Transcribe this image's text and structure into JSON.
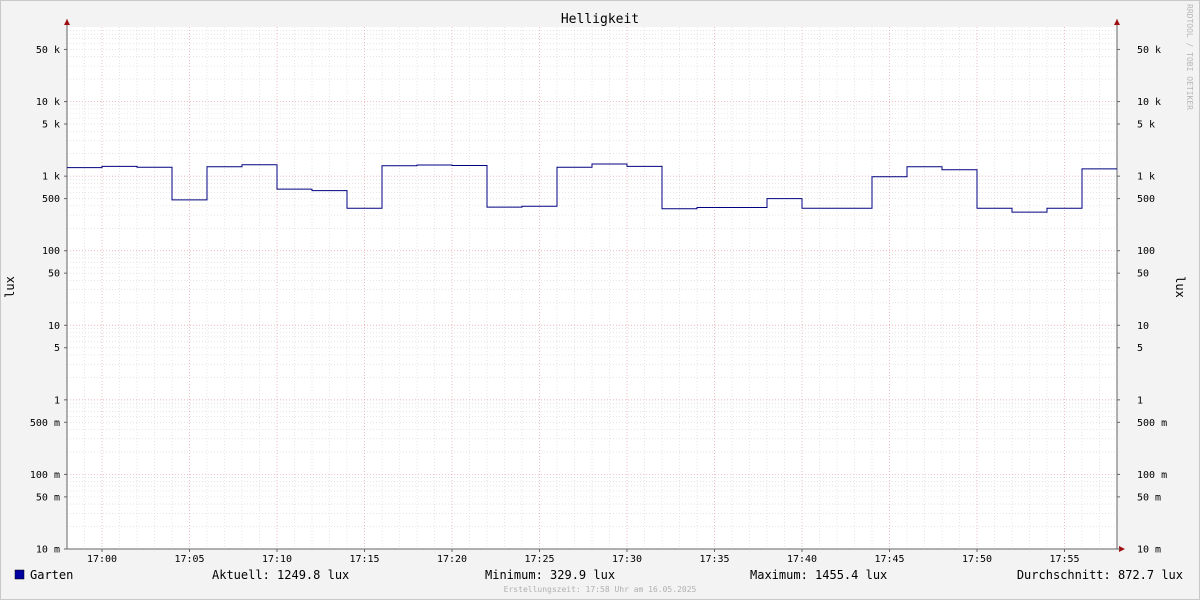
{
  "chart_data": {
    "type": "line",
    "title": "Helligkeit",
    "ylabel": "lux",
    "y_scale": "log",
    "ylim": [
      0.01,
      100000
    ],
    "y_tick_values": [
      0.01,
      0.05,
      0.1,
      0.5,
      1,
      5,
      10,
      50,
      100,
      500,
      1000,
      5000,
      10000,
      50000
    ],
    "y_tick_labels": [
      "10 m",
      "50 m",
      "100 m",
      "500 m",
      "1",
      "5",
      "10",
      "50",
      "100",
      "500",
      "1 k",
      "5 k",
      "10 k",
      "50 k"
    ],
    "x_range": [
      "16:58",
      "17:58"
    ],
    "x_ticks": [
      "17:00",
      "17:05",
      "17:10",
      "17:15",
      "17:20",
      "17:25",
      "17:30",
      "17:35",
      "17:40",
      "17:45",
      "17:50",
      "17:55"
    ],
    "grid": true,
    "series": [
      {
        "name": "Garten",
        "color": "#000080",
        "step": true,
        "points": [
          [
            "16:58",
            1300
          ],
          [
            "17:00",
            1350
          ],
          [
            "17:02",
            1320
          ],
          [
            "17:04",
            480
          ],
          [
            "17:06",
            1340
          ],
          [
            "17:08",
            1420
          ],
          [
            "17:10",
            670
          ],
          [
            "17:12",
            640
          ],
          [
            "17:14",
            370
          ],
          [
            "17:16",
            1380
          ],
          [
            "17:18",
            1410
          ],
          [
            "17:20",
            1390
          ],
          [
            "17:22",
            385
          ],
          [
            "17:24",
            395
          ],
          [
            "17:26",
            1320
          ],
          [
            "17:28",
            1455.4
          ],
          [
            "17:30",
            1350
          ],
          [
            "17:32",
            365
          ],
          [
            "17:34",
            380
          ],
          [
            "17:36",
            380
          ],
          [
            "17:38",
            500
          ],
          [
            "17:40",
            370
          ],
          [
            "17:42",
            370
          ],
          [
            "17:44",
            980
          ],
          [
            "17:46",
            1340
          ],
          [
            "17:48",
            1220
          ],
          [
            "17:50",
            370
          ],
          [
            "17:52",
            329.9
          ],
          [
            "17:54",
            370
          ],
          [
            "17:56",
            1249.8
          ],
          [
            "17:58",
            1249.8
          ]
        ]
      }
    ]
  },
  "watermark": "RRDTOOL / TOBI OETIKER",
  "legend": {
    "series_name": "Garten",
    "swatch_color": "#0000a0",
    "current": "Aktuell: 1249.8 lux",
    "minimum": "Minimum: 329.9 lux",
    "maximum": "Maximum: 1455.4 lux",
    "average": "Durchschnitt: 872.7 lux"
  },
  "footer": "Erstellungszeit: 17:58 Uhr am 16.05.2025"
}
